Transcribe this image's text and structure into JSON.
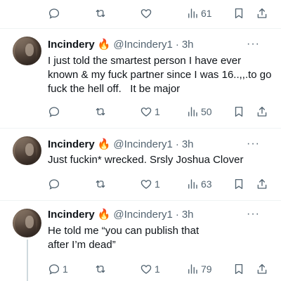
{
  "top_actions": {
    "reply_count": "",
    "retweet_count": "",
    "like_count": "",
    "views_count": "61"
  },
  "tweets": [
    {
      "display_name": "Incindery",
      "emoji": "🔥",
      "handle": "@Incindery1",
      "separator": "·",
      "time": "3h",
      "more": "···",
      "text": "I just told the smartest person I have ever known & my fuck partner since I was 16..,,.to go fuck the hell off.   It be major",
      "reply_count": "",
      "retweet_count": "",
      "like_count": "1",
      "views_count": "50"
    },
    {
      "display_name": "Incindery",
      "emoji": "🔥",
      "handle": "@Incindery1",
      "separator": "·",
      "time": "3h",
      "more": "···",
      "text": "Just fuckin* wrecked. Srsly Joshua Clover",
      "reply_count": "",
      "retweet_count": "",
      "like_count": "1",
      "views_count": "63"
    },
    {
      "display_name": "Incindery",
      "emoji": "🔥",
      "handle": "@Incindery1",
      "separator": "·",
      "time": "3h",
      "more": "···",
      "text": "He told me “you can publish that after I’m dead”",
      "reply_count": "1",
      "retweet_count": "",
      "like_count": "1",
      "views_count": "79"
    }
  ],
  "icons": {
    "reply": "reply-icon",
    "retweet": "retweet-icon",
    "like": "heart-icon",
    "views": "views-icon",
    "bookmark": "bookmark-icon",
    "share": "share-icon"
  },
  "colors": {
    "text_primary": "#0f1419",
    "text_secondary": "#536471",
    "divider": "#eff3f4",
    "thread_line": "#cfd9de"
  }
}
